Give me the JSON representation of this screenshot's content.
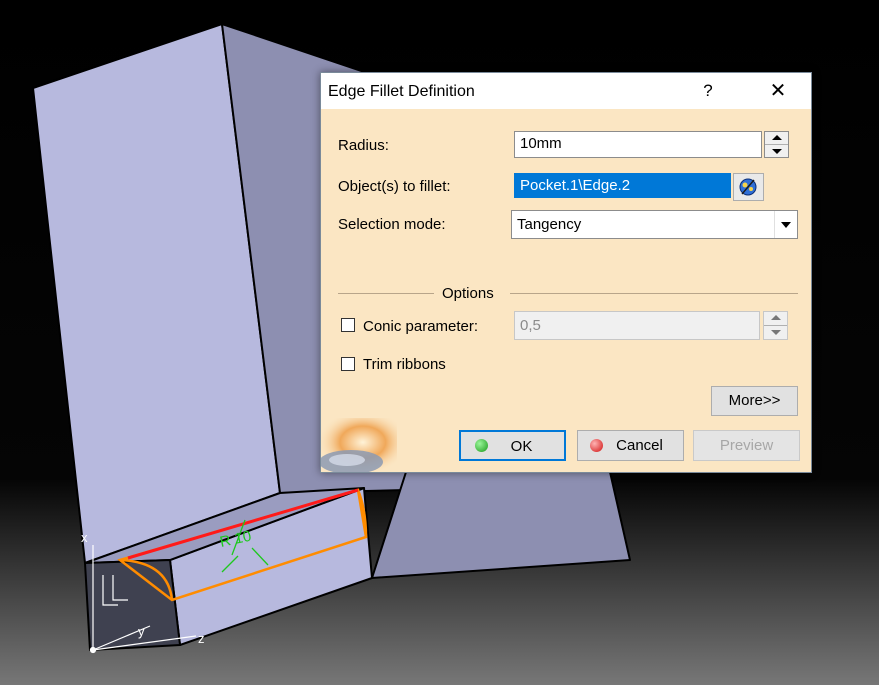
{
  "dialog": {
    "title": "Edge Fillet Definition",
    "help_label": "?",
    "close_label": "✕",
    "radius": {
      "label": "Radius:",
      "value": "10mm"
    },
    "objects": {
      "label": "Object(s) to fillet:",
      "value": "Pocket.1\\Edge.2"
    },
    "selection_mode": {
      "label": "Selection mode:",
      "value": "Tangency"
    },
    "options": {
      "heading": "Options",
      "conic": {
        "label": "Conic parameter:",
        "value": "0,5",
        "checked": false
      },
      "trim": {
        "label": "Trim ribbons",
        "checked": false
      }
    },
    "buttons": {
      "more": "More>>",
      "ok": "OK",
      "cancel": "Cancel",
      "preview": "Preview"
    }
  },
  "viewport": {
    "dimension_label": "R 10",
    "axis_x": "x",
    "axis_y": "y",
    "axis_z": "z"
  },
  "colors": {
    "part_front": "#b7b9de",
    "part_side": "#8d8fb1",
    "dialog_bg": "#fbe6c3",
    "selection_blue": "#0078d7",
    "edge_highlight_orange": "#ff8c00",
    "edge_selected_red": "#ff1a1a",
    "dimension_green": "#1ec81e"
  }
}
